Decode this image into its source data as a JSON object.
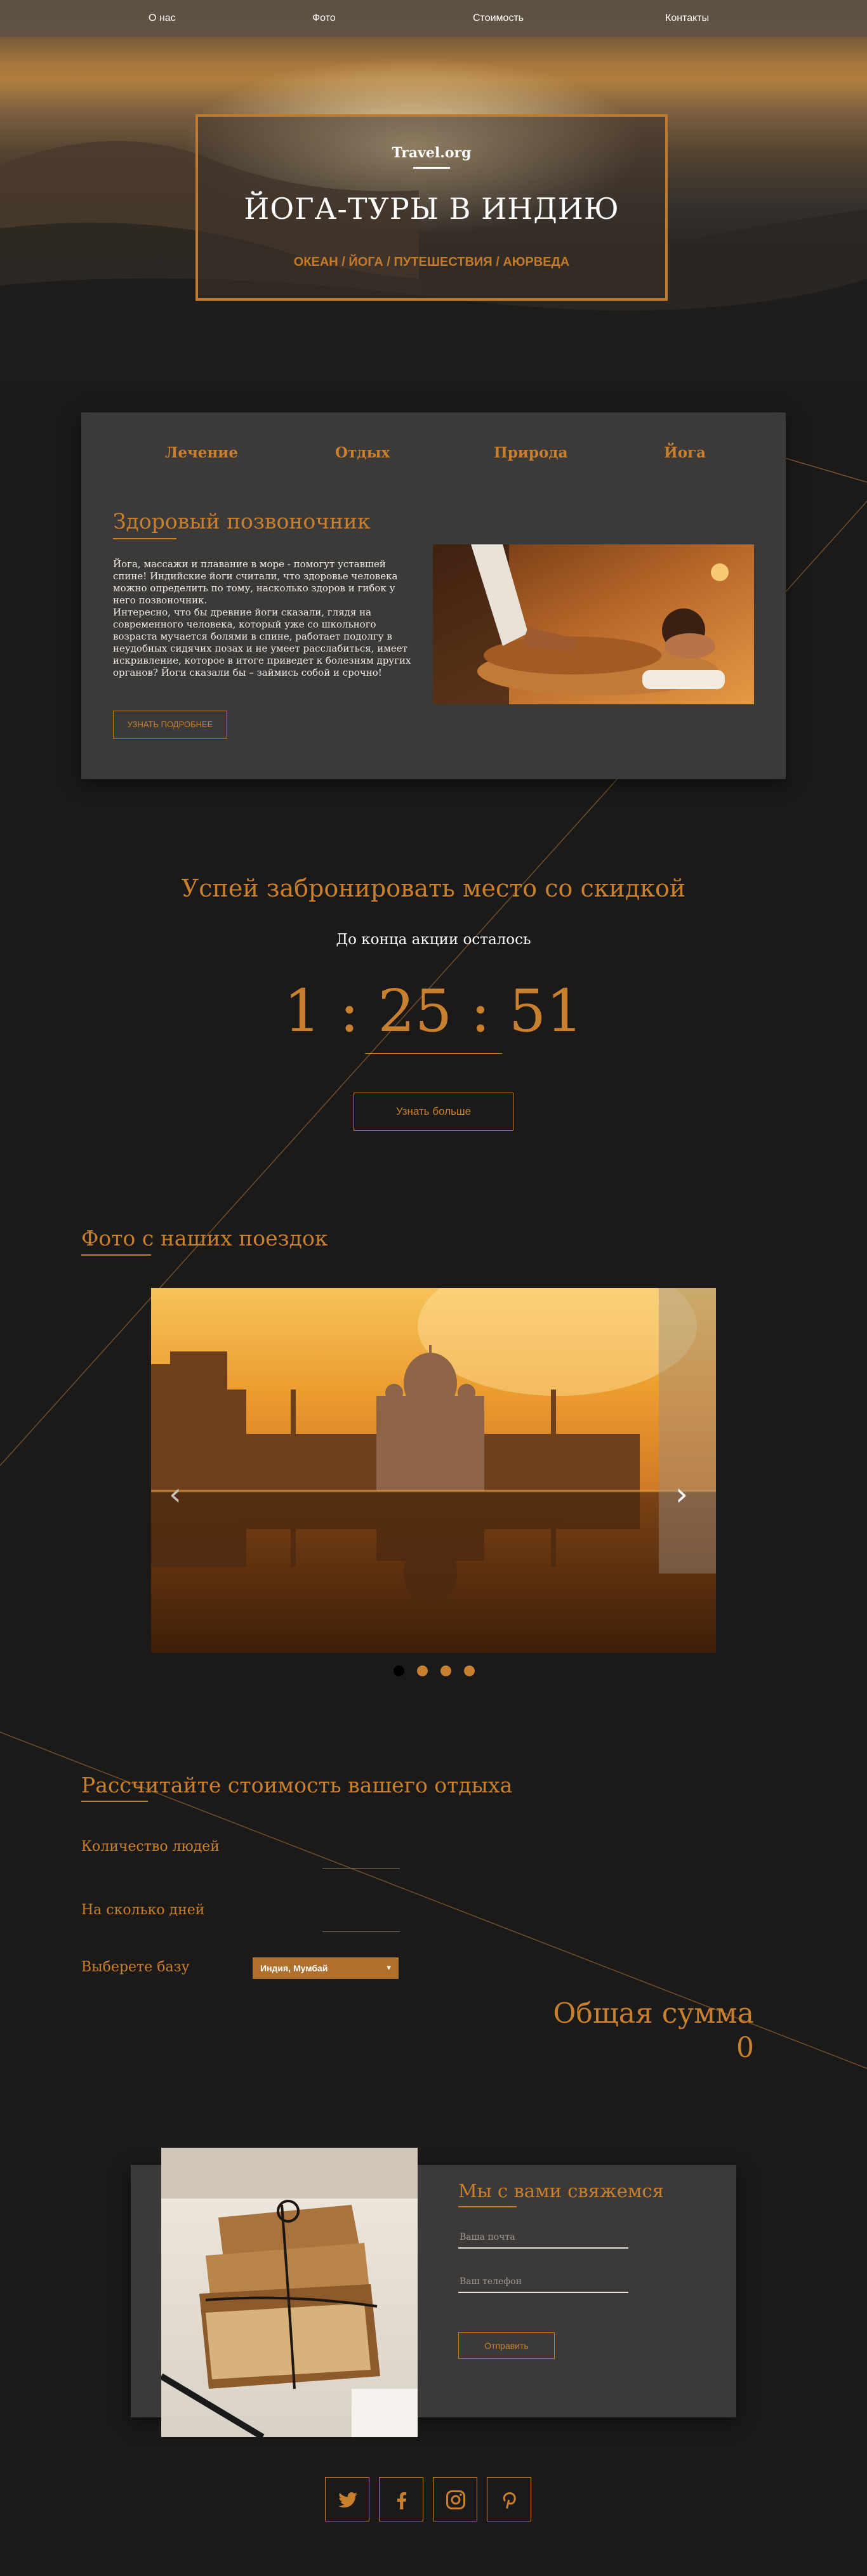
{
  "nav": {
    "items": [
      {
        "label": "О нас"
      },
      {
        "label": "Фото"
      },
      {
        "label": "Стоимость"
      },
      {
        "label": "Контакты"
      }
    ]
  },
  "hero": {
    "brand": "Travel.org",
    "title": "ЙОГА-ТУРЫ В ИНДИЮ",
    "tags": "ОКЕАН / ЙОГА / ПУТЕШЕСТВИЯ / АЮРВЕДА"
  },
  "tabs": {
    "items": [
      {
        "label": "Лечение"
      },
      {
        "label": "Отдых"
      },
      {
        "label": "Природа"
      },
      {
        "label": "Йога"
      }
    ],
    "article": {
      "title": "Здоровый позвоночник",
      "text": "Йога, массажи и плавание в море - помогут уставшей\nспине! Индийские йоги считали, что здоровье человека\nможно определить по тому, насколько здоров и гибок у\nнего позвоночник.\nИнтересно, что бы древние йоги сказали, глядя на\nсовременного человека, который уже со школьного\nвозраста мучается болями в спине, работает подолгу в\nнеудобных сидячих позах и не умеет расслабиться, имеет\nискривление, которое в итоге приведет к болезням других\nорганов? Йоги сказали бы – займись собой и срочно!",
      "button": "УЗНАТЬ ПОДРОБНЕЕ"
    }
  },
  "promo": {
    "title": "Успей забронировать место со скидкой",
    "subtitle": "До конца акции осталось",
    "hours": "1",
    "minutes": "25",
    "seconds": "51",
    "separator": ":",
    "button": "Узнать больше"
  },
  "gallery": {
    "title": "Фото с наших поездок",
    "slide_count": 4,
    "active_slide": 1
  },
  "calculator": {
    "title": "Рассчитайте стоимость вашего отдыха",
    "people_label": "Количество людей",
    "days_label": "На сколько дней",
    "base_label": "Выберете базу",
    "base_value": "Индия, Мумбай",
    "total_label": "Общая сумма",
    "total_value": "0"
  },
  "contact": {
    "title": "Мы с вами свяжемся",
    "email_placeholder": "Ваша почта",
    "phone_placeholder": "Ваш телефон",
    "submit": "Отправить"
  },
  "social": [
    "twitter-icon",
    "facebook-icon",
    "instagram-icon",
    "pinterest-icon"
  ],
  "colors": {
    "accent": "#c8802f",
    "background": "#1b1a19",
    "panel": "#3b3a39"
  }
}
